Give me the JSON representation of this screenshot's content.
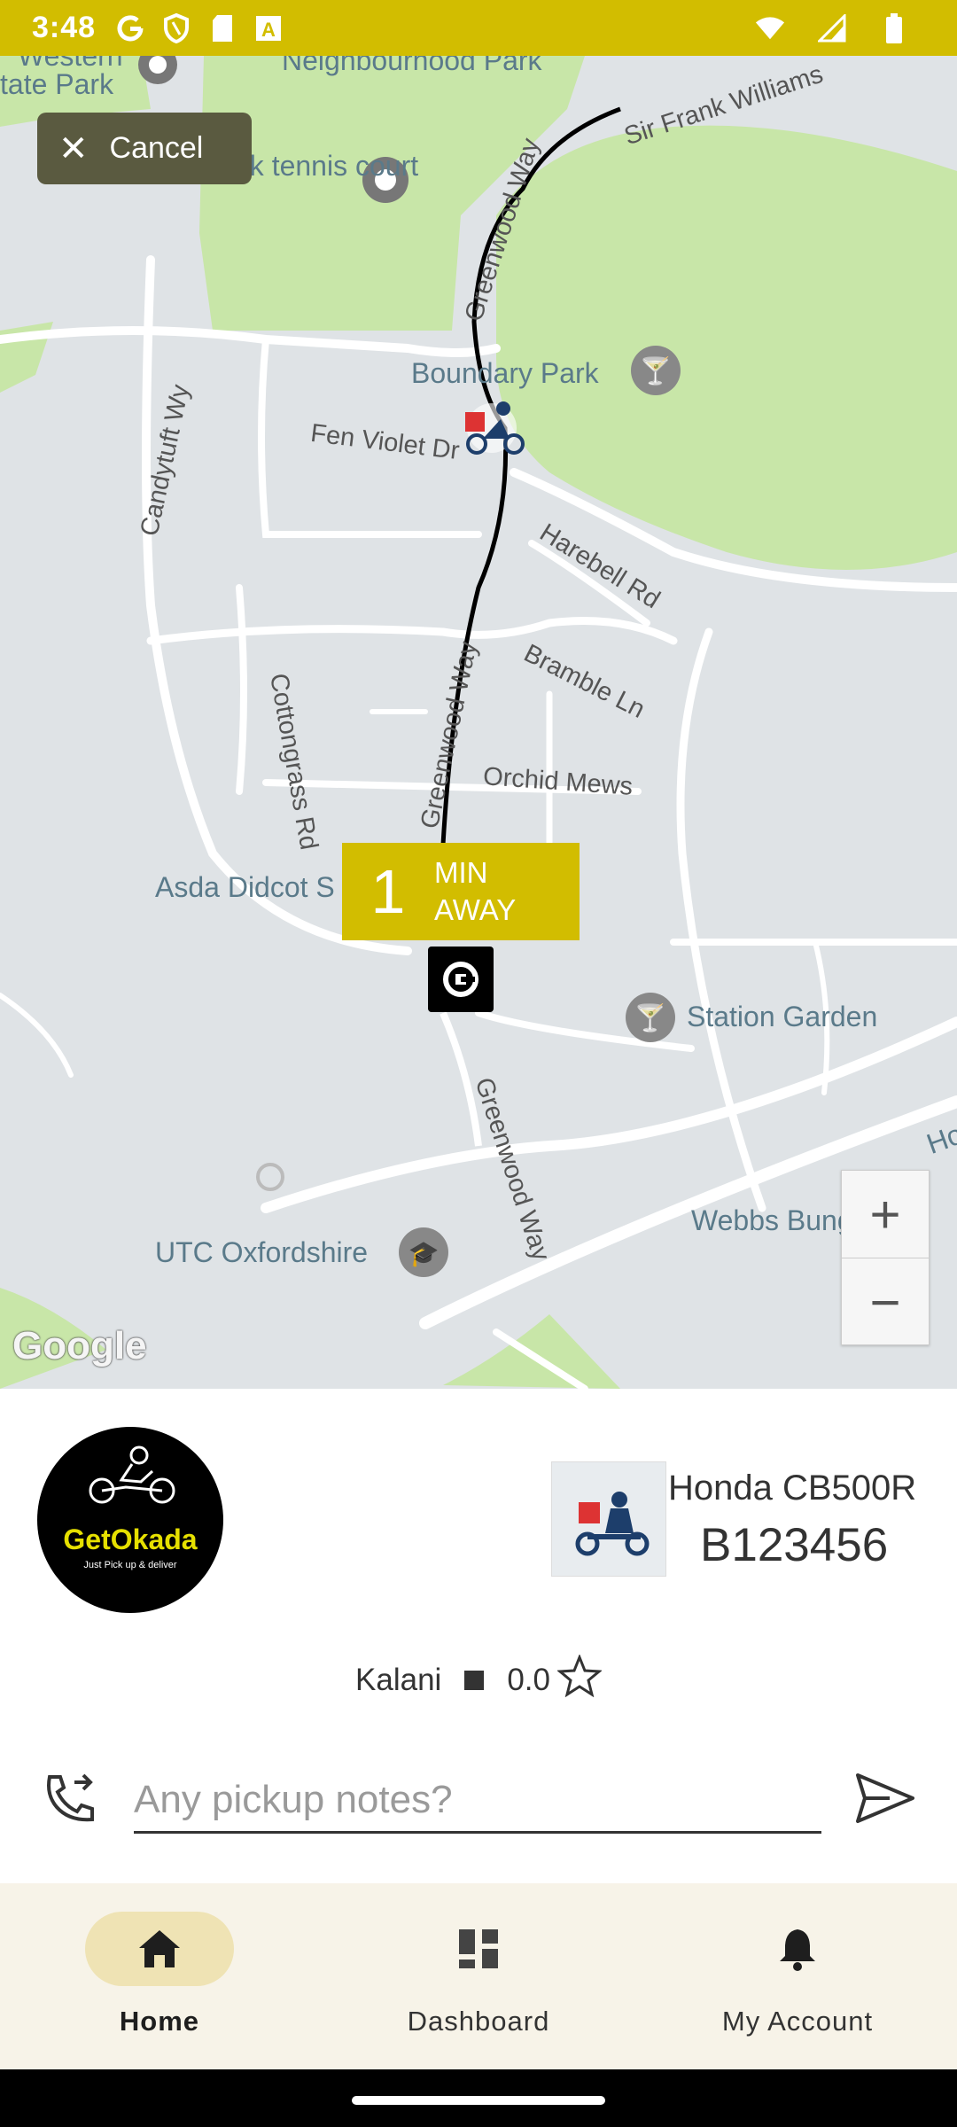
{
  "status_bar": {
    "time": "3:48",
    "icons": [
      "google-icon",
      "shield-icon",
      "sd-card-icon",
      "translate-icon",
      "wifi-icon",
      "signal-icon",
      "battery-icon"
    ]
  },
  "map": {
    "labels": {
      "neighbourhood_park": "Neighbourhood Park",
      "western_park_partial": "Western",
      "state_park_partial": "tate Park",
      "tennis_court": "ry park tennis court",
      "boundary_park": "Boundary Park",
      "asda": "Asda Didcot S",
      "station_garden": "Station Garden",
      "webbs": "Webbs Bungalows",
      "utc": "UTC Oxfordshire",
      "ho_partial": "Ho"
    },
    "roads": {
      "sir_frank": "Sir Frank Williams",
      "greenwood_upper": "Greenwood Way",
      "greenwood_mid": "Greenwood Way",
      "greenwood_lower": "Greenwood Way",
      "fen_violet": "Fen Violet Dr",
      "candytuft": "Candytuft Wy",
      "harebell": "Harebell Rd",
      "bramble": "Bramble Ln",
      "cottongrass": "Cottongrass Rd",
      "orchid": "Orchid Mews"
    },
    "cancel_label": "Cancel",
    "eta": {
      "number": "1",
      "unit_line1": "MIN",
      "unit_line2": "AWAY"
    },
    "zoom_in": "+",
    "zoom_out": "−",
    "attribution": "Google",
    "colors": {
      "route": "#000000",
      "park": "#c8e6a8",
      "eta_bg": "#d2bd00"
    }
  },
  "ride": {
    "logo_brand": "GetOkada",
    "logo_tagline": "Just Pick up & deliver",
    "vehicle_model": "Honda CB500R",
    "vehicle_plate": "B123456",
    "driver_name": "Kalani",
    "rating": "0.0",
    "notes_placeholder": "Any pickup notes?"
  },
  "nav": {
    "items": [
      {
        "label": "Home",
        "icon": "home-icon",
        "active": true
      },
      {
        "label": "Dashboard",
        "icon": "dashboard-icon",
        "active": false
      },
      {
        "label": "My Account",
        "icon": "bell-icon",
        "active": false
      }
    ]
  }
}
